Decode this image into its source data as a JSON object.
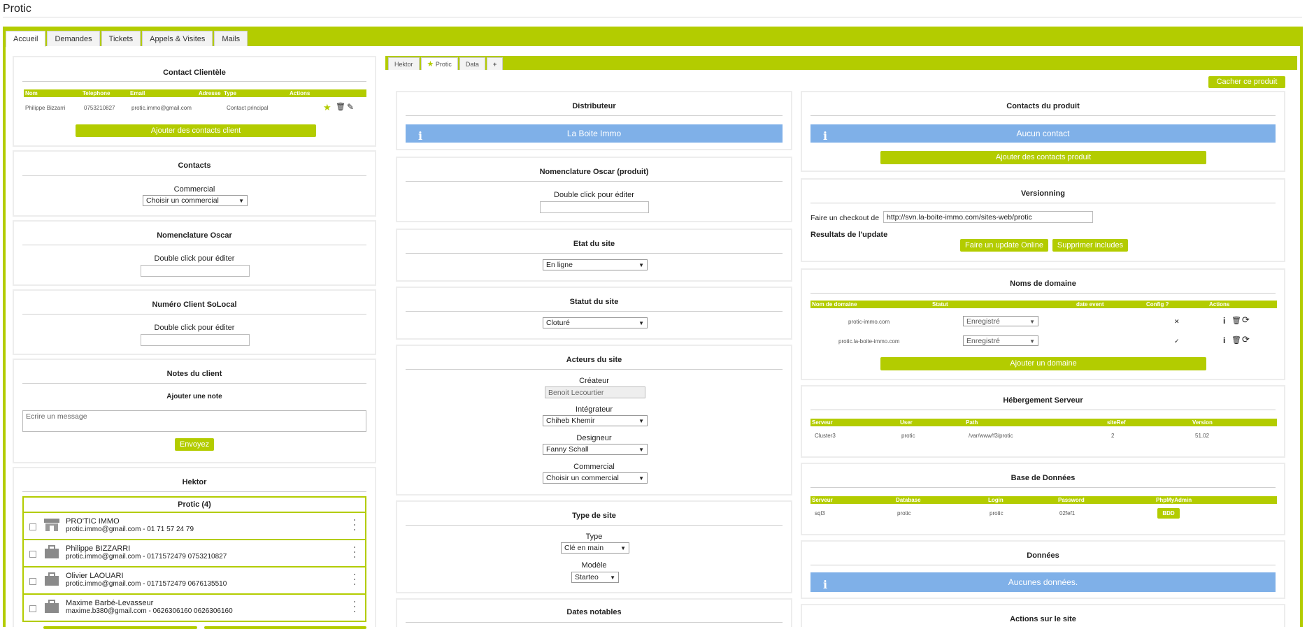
{
  "app": {
    "title": "Protic"
  },
  "main_tabs": [
    "Accueil",
    "Demandes",
    "Tickets",
    "Appels & Visites",
    "Mails"
  ],
  "colors": {
    "accent": "#b3cc00",
    "info": "#7fb0e8"
  },
  "contact_clientele": {
    "title": "Contact Clientèle",
    "columns": [
      "Nom",
      "Telephone",
      "Email",
      "Adresse",
      "Type",
      "Actions"
    ],
    "row": {
      "nom": "Philippe Bizzarri",
      "telephone": "0753210827",
      "email": "protic.immo@gmail.com",
      "adresse": "",
      "type": "Contact principal"
    },
    "add_button": "Ajouter des contacts client"
  },
  "contacts": {
    "title": "Contacts",
    "label": "Commercial",
    "select_value": "Choisir un commercial"
  },
  "nomenclature_oscar": {
    "title": "Nomenclature Oscar",
    "hint": "Double click pour éditer"
  },
  "numero_solocal": {
    "title": "Numéro Client SoLocal",
    "hint": "Double click pour éditer"
  },
  "notes": {
    "title": "Notes du client",
    "subtitle": "Ajouter une note",
    "placeholder": "Ecrire un message",
    "send_button": "Envoyez"
  },
  "hektor": {
    "title": "Hektor",
    "group": "Protic (4)",
    "items": [
      {
        "icon": "store-icon",
        "name": "PRO'TIC IMMO",
        "details": "protic.immo@gmail.com - 01 71 57 24 79"
      },
      {
        "icon": "briefcase-icon",
        "name": "Philippe BIZZARRI",
        "details": "protic.immo@gmail.com - 0171572479 0753210827"
      },
      {
        "icon": "briefcase-icon",
        "name": "Olivier LAOUARI",
        "details": "protic.immo@gmail.com - 0171572479 0676135510"
      },
      {
        "icon": "briefcase-icon",
        "name": "Maxime Barbé-Levasseur",
        "details": "maxime.b380@gmail.com - 0626306160 0626306160"
      }
    ]
  },
  "sub_tabs": [
    "Hektor",
    "Protic",
    "Data",
    "+"
  ],
  "hide_product_button": "Cacher ce produit",
  "distributeur": {
    "title": "Distributeur",
    "value": "La Boite Immo"
  },
  "nomenclature_produit": {
    "title": "Nomenclature Oscar (produit)",
    "hint": "Double click pour éditer"
  },
  "etat_site": {
    "title": "Etat du site",
    "value": "En ligne"
  },
  "statut_site": {
    "title": "Statut du site",
    "value": "Cloturé"
  },
  "acteurs": {
    "title": "Acteurs du site",
    "createur_label": "Créateur",
    "createur_value": "Benoit Lecourtier",
    "integrateur_label": "Intégrateur",
    "integrateur_value": "Chiheb Khemir",
    "designeur_label": "Designeur",
    "designeur_value": "Fanny Schall",
    "commercial_label": "Commercial",
    "commercial_value": "Choisir un commercial"
  },
  "type_site": {
    "title": "Type de site",
    "type_label": "Type",
    "type_value": "Clé en main",
    "modele_label": "Modèle",
    "modele_value": "Starteo"
  },
  "dates_notables": {
    "title": "Dates notables"
  },
  "contacts_produit": {
    "title": "Contacts du produit",
    "info": "Aucun contact",
    "add_button": "Ajouter des contacts produit"
  },
  "versionning": {
    "title": "Versionning",
    "checkout_label": "Faire un checkout de",
    "checkout_url": "http://svn.la-boite-immo.com/sites-web/protic",
    "results_label": "Resultats de l'update",
    "update_button": "Faire un update Online",
    "remove_button": "Supprimer includes"
  },
  "domaines": {
    "title": "Noms de domaine",
    "columns": [
      "Nom de domaine",
      "Statut",
      "date event",
      "Config ?",
      "Actions"
    ],
    "rows": [
      {
        "name": "protic-immo.com",
        "statut": "Enregistré",
        "config": "✕"
      },
      {
        "name": "protic.la-boite-immo.com",
        "statut": "Enregistré",
        "config": "✓"
      }
    ],
    "add_button": "Ajouter un domaine"
  },
  "hebergement": {
    "title": "Hébergement Serveur",
    "columns": [
      "Serveur",
      "User",
      "Path",
      "siteRef",
      "Version"
    ],
    "row": {
      "serveur": "Cluster3",
      "user": "protic",
      "path": "/var/www/f3/protic",
      "siteref": "2",
      "version": "51.02"
    }
  },
  "bdd": {
    "title": "Base de Données",
    "columns": [
      "Serveur",
      "Database",
      "Login",
      "Password",
      "PhpMyAdmin"
    ],
    "row": {
      "serveur": "sql3",
      "database": "protic",
      "login": "protic",
      "password": "02fef1",
      "button": "BDD"
    }
  },
  "donnees": {
    "title": "Données",
    "info": "Aucunes données."
  },
  "actions_site": {
    "title": "Actions sur le site"
  }
}
